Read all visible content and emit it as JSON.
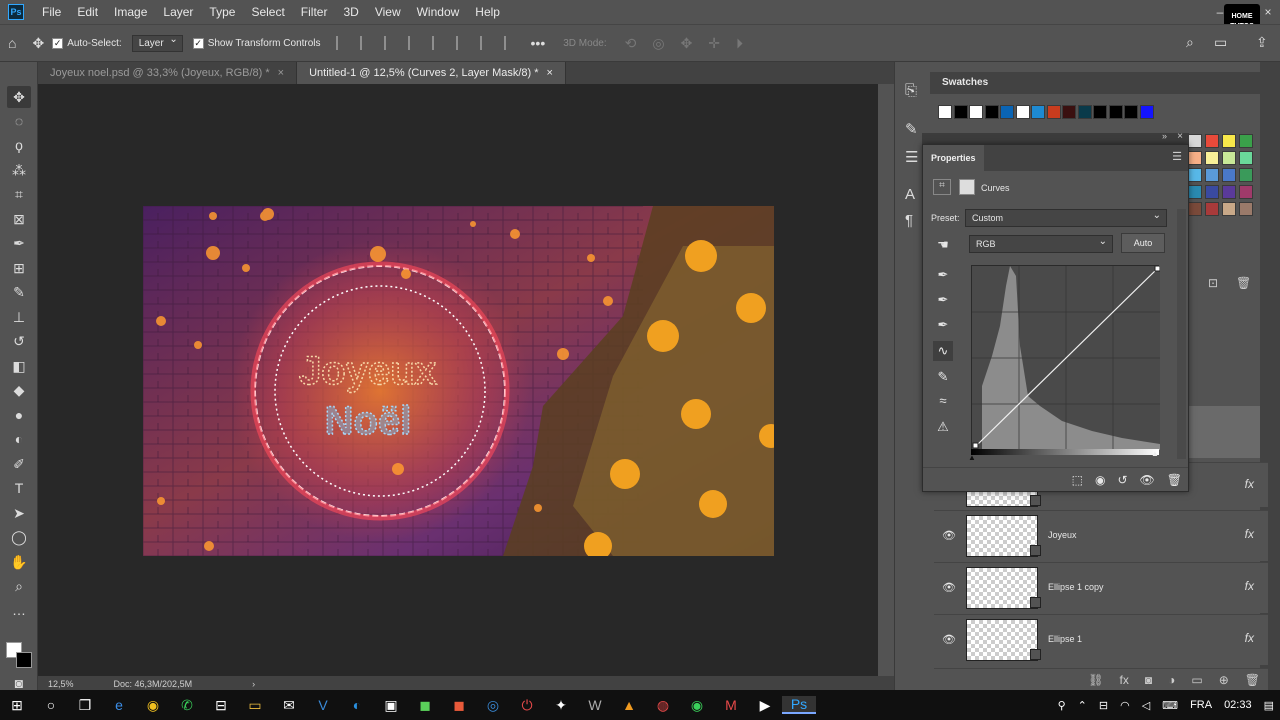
{
  "app": {
    "logo": "Ps"
  },
  "menu": [
    "File",
    "Edit",
    "Image",
    "Layer",
    "Type",
    "Select",
    "Filter",
    "3D",
    "View",
    "Window",
    "Help"
  ],
  "window_controls": [
    "–",
    "□",
    "×"
  ],
  "brand_badge": "HOME TUTOS",
  "options_bar": {
    "auto_select_label": "Auto-Select:",
    "auto_select_value": "Layer",
    "show_transform_label": "Show Transform Controls",
    "mode_3d_label": "3D Mode:"
  },
  "tabs": [
    {
      "label": "Joyeux noel.psd @ 33,3% (Joyeux, RGB/8) *",
      "active": false
    },
    {
      "label": "Untitled-1 @ 12,5% (Curves 2, Layer Mask/8) *",
      "active": true
    }
  ],
  "artwork": {
    "line1": "Joyeux",
    "line2": "Noël"
  },
  "status": {
    "zoom": "12,5%",
    "doc": "Doc: 46,3M/202,5M"
  },
  "swatches": {
    "title": "Swatches",
    "colors": [
      "#ffffff",
      "#000000",
      "#ffffff",
      "#000000",
      "#0a64b4",
      "#ffffff",
      "#1e8ad2",
      "#c83c1e",
      "#3a1010",
      "#0a3a4a",
      "#000000",
      "#000000",
      "#000000",
      "#1414ff"
    ]
  },
  "color_grid": [
    "#d8d8d8",
    "#e84a3a",
    "#f8e84a",
    "#3aa04a",
    "#f8b088",
    "#f8f098",
    "#c8e898",
    "#6ad89a",
    "#58b8e8",
    "#5a9ad8",
    "#4a78c8",
    "#3a9a5a",
    "#2a8ab0",
    "#3a4aa0",
    "#5a3a9a",
    "#a03a6a",
    "#7a4a3a",
    "#a83a3a",
    "#c8a888",
    "#9a7a6a"
  ],
  "properties": {
    "title": "Properties",
    "adjustment": "Curves",
    "preset_label": "Preset:",
    "preset_value": "Custom",
    "channel": "RGB",
    "auto_label": "Auto"
  },
  "layers": [
    {
      "name": "",
      "fx": "fx"
    },
    {
      "name": "Joyeux",
      "fx": "fx"
    },
    {
      "name": "Ellipse 1 copy",
      "fx": "fx"
    },
    {
      "name": "Ellipse 1",
      "fx": "fx"
    }
  ],
  "taskbar": {
    "lang": "FRA",
    "time": "02:33"
  }
}
